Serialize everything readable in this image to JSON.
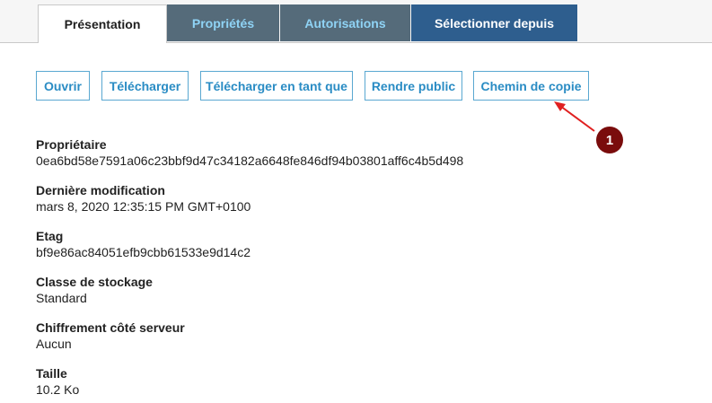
{
  "tabs": [
    {
      "label": "Présentation",
      "active": true
    },
    {
      "label": "Propriétés",
      "active": false
    },
    {
      "label": "Autorisations",
      "active": false
    },
    {
      "label": "Sélectionner depuis",
      "active": false
    }
  ],
  "actions": {
    "open": "Ouvrir",
    "download": "Télécharger",
    "download_as": "Télécharger en tant que",
    "make_public": "Rendre public",
    "copy_path": "Chemin de copie"
  },
  "details": [
    {
      "label": "Propriétaire",
      "value": "0ea6bd58e7591a06c23bbf9d47c34182a6648fe846df94b03801aff6c4b5d498"
    },
    {
      "label": "Dernière modification",
      "value": "mars 8, 2020 12:35:15 PM GMT+0100"
    },
    {
      "label": "Etag",
      "value": "bf9e86ac84051efb9cbb61533e9d14c2"
    },
    {
      "label": "Classe de stockage",
      "value": "Standard"
    },
    {
      "label": "Chiffrement côté serveur",
      "value": "Aucun"
    },
    {
      "label": "Taille",
      "value": "10.2 Ko"
    }
  ],
  "annotation": {
    "number": "1",
    "color": "#7a0c0c",
    "arrow_color": "#e02020"
  }
}
